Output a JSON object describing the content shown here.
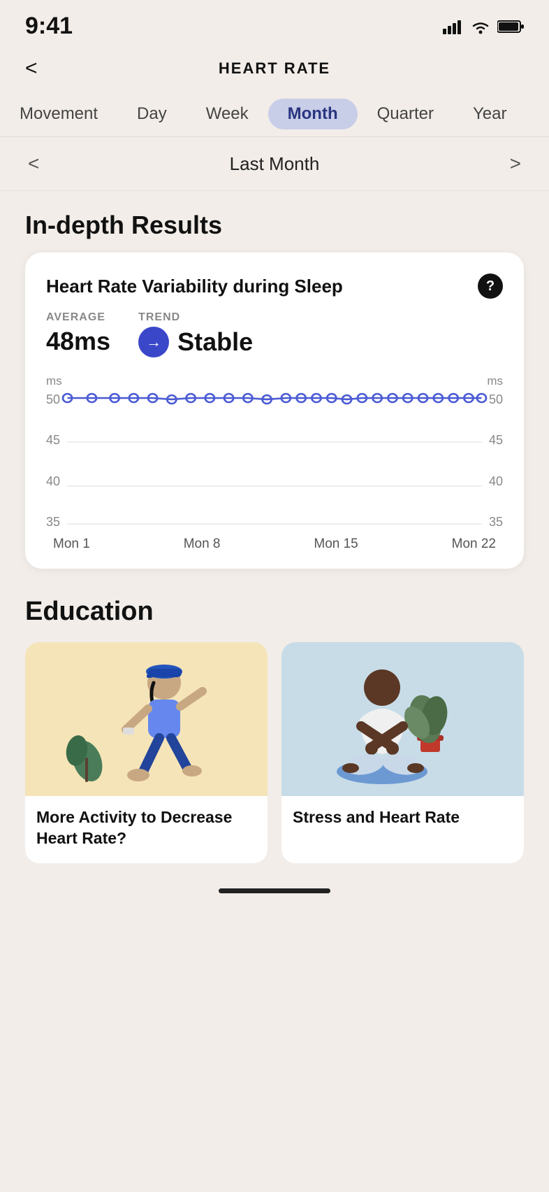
{
  "statusBar": {
    "time": "9:41"
  },
  "header": {
    "backLabel": "<",
    "title": "HEART RATE"
  },
  "tabs": [
    {
      "id": "movement",
      "label": "Movement",
      "active": false
    },
    {
      "id": "day",
      "label": "Day",
      "active": false
    },
    {
      "id": "week",
      "label": "Week",
      "active": false
    },
    {
      "id": "month",
      "label": "Month",
      "active": true
    },
    {
      "id": "quarter",
      "label": "Quarter",
      "active": false
    },
    {
      "id": "year",
      "label": "Year",
      "active": false
    }
  ],
  "periodNav": {
    "prevLabel": "<",
    "nextLabel": ">",
    "currentLabel": "Last Month"
  },
  "inDepthResults": {
    "sectionTitle": "In-depth Results"
  },
  "hrvCard": {
    "title": "Heart Rate Variability during Sleep",
    "infoLabel": "?",
    "averageLabel": "AVERAGE",
    "averageValue": "48ms",
    "trendLabel": "TREND",
    "trendValue": "Stable",
    "msLabelLeft": "ms",
    "msLabelRight": "ms",
    "yLabels": [
      "50",
      "45",
      "40",
      "35"
    ],
    "yLabelsRight": [
      "50",
      "45",
      "40",
      "35"
    ],
    "xLabels": [
      "Mon 1",
      "Mon 8",
      "Mon 15",
      "Mon 22"
    ],
    "chartData": {
      "lineY": 50,
      "minY": 35,
      "maxY": 55
    }
  },
  "education": {
    "sectionTitle": "Education",
    "cards": [
      {
        "id": "activity",
        "imgStyle": "yellow",
        "title": "More Activity to Decrease Heart Rate?"
      },
      {
        "id": "stress",
        "imgStyle": "blue",
        "title": "Stress and Heart Rate"
      }
    ]
  },
  "homeIndicator": {}
}
